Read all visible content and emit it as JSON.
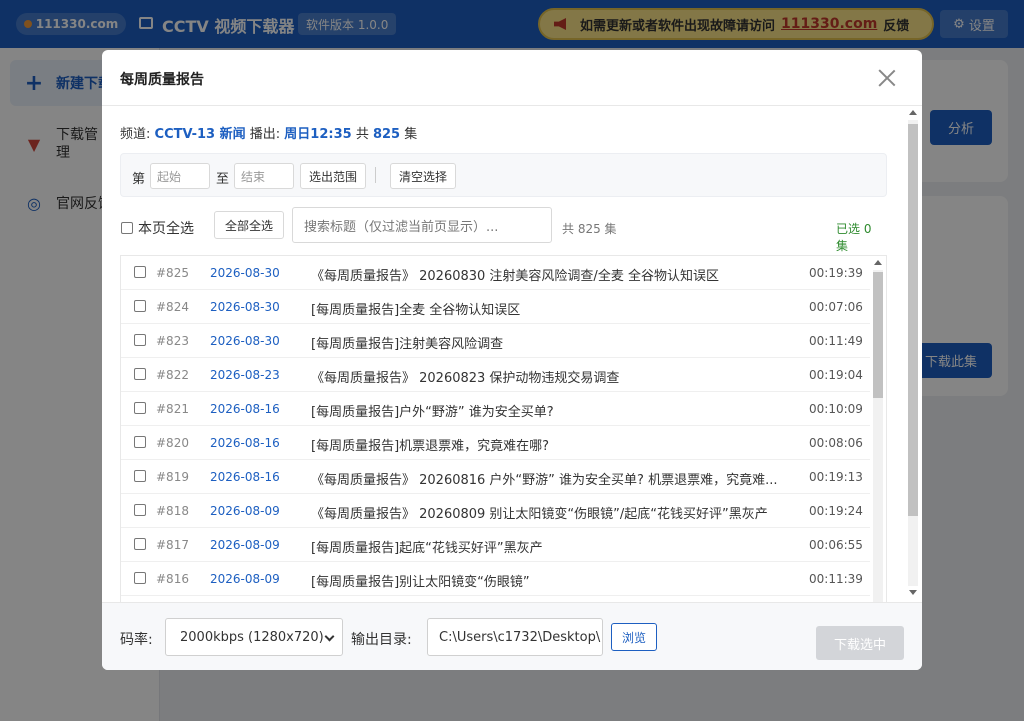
{
  "topbar": {
    "site": "111330.com",
    "app_title": "CCTV 视频下载器",
    "version": "软件版本 1.0.0",
    "notice_text": "如需更新或者软件出现故障请访问",
    "notice_link": "111330.com",
    "notice_feedback": "反馈",
    "settings_label": "设置",
    "colors": {
      "bar": "#1d5fc1",
      "notice_bg": "#fbe589",
      "notice_link": "#c0392b"
    }
  },
  "sidebar": {
    "items": [
      {
        "label": "新建下载",
        "icon": "plus-icon",
        "active": true
      },
      {
        "label": "下载管理",
        "icon": "download-box-icon",
        "active": false
      },
      {
        "label": "官网反馈",
        "icon": "globe-icon",
        "active": false
      }
    ]
  },
  "background": {
    "analyze_button": "分析",
    "download_series_button": "下载此集"
  },
  "modal": {
    "title": "每周质量报告",
    "channel_label": "频道:",
    "channel": "CCTV-13 新闻",
    "air_label": "播出:",
    "air_time": "周日12:35",
    "total_prefix": "共",
    "total_count": "825",
    "total_suffix": "集",
    "range": {
      "from_label": "第",
      "start_placeholder": "起始",
      "to_label": "至",
      "end_placeholder": "结束",
      "select_range_button": "选出范围",
      "clear_button": "清空选择"
    },
    "select_page_all": "本页全选",
    "select_all_button": "全部全选",
    "search_placeholder": "搜索标题（仅过滤当前页显示）...",
    "list_total": "共 825 集",
    "selected_status": "已选 0 集",
    "episodes": [
      {
        "num": "#825",
        "date": "2026-08-30",
        "title": "《每周质量报告》 20260830 注射美容风险调查/全麦 全谷物认知误区",
        "duration": "00:19:39"
      },
      {
        "num": "#824",
        "date": "2026-08-30",
        "title": "[每周质量报告]全麦 全谷物认知误区",
        "duration": "00:07:06"
      },
      {
        "num": "#823",
        "date": "2026-08-30",
        "title": "[每周质量报告]注射美容风险调查",
        "duration": "00:11:49"
      },
      {
        "num": "#822",
        "date": "2026-08-23",
        "title": "《每周质量报告》 20260823 保护动物违规交易调查",
        "duration": "00:19:04"
      },
      {
        "num": "#821",
        "date": "2026-08-16",
        "title": "[每周质量报告]户外“野游” 谁为安全买单?",
        "duration": "00:10:09"
      },
      {
        "num": "#820",
        "date": "2026-08-16",
        "title": "[每周质量报告]机票退票难，究竟难在哪?",
        "duration": "00:08:06"
      },
      {
        "num": "#819",
        "date": "2026-08-16",
        "title": "《每周质量报告》 20260816 户外“野游” 谁为安全买单? 机票退票难，究竟难...",
        "duration": "00:19:13"
      },
      {
        "num": "#818",
        "date": "2026-08-09",
        "title": "《每周质量报告》 20260809 别让太阳镜变“伤眼镜”/起底“花钱买好评”黑灰产",
        "duration": "00:19:24"
      },
      {
        "num": "#817",
        "date": "2026-08-09",
        "title": "[每周质量报告]起底“花钱买好评”黑灰产",
        "duration": "00:06:55"
      },
      {
        "num": "#816",
        "date": "2026-08-09",
        "title": "[每周质量报告]别让太阳镜变“伤眼镜”",
        "duration": "00:11:39"
      }
    ],
    "footer": {
      "bitrate_label": "码率:",
      "bitrate_value": "2000kbps (1280x720)",
      "output_label": "输出目录:",
      "output_dir": "C:\\Users\\c1732\\Desktop\\",
      "browse_button": "浏览",
      "download_button": "下载选中"
    }
  }
}
